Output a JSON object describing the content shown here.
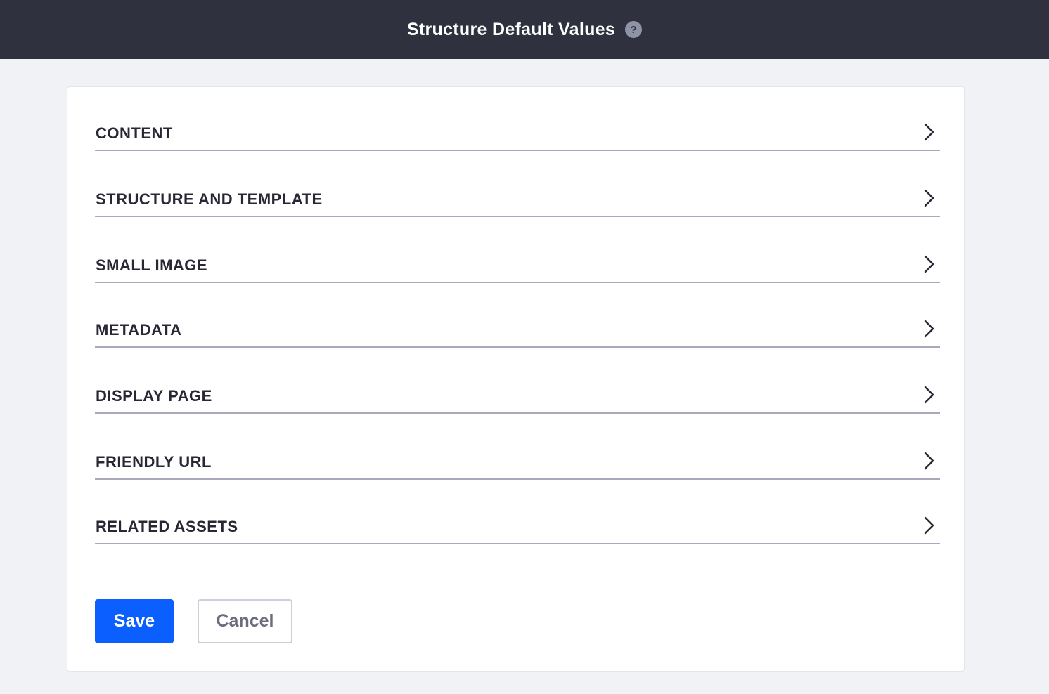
{
  "header": {
    "title": "Structure Default Values",
    "help_icon": "?",
    "help_icon_name": "question-circle-icon"
  },
  "sections": [
    {
      "label": "CONTENT",
      "icon": "chevron-right-icon"
    },
    {
      "label": "STRUCTURE AND TEMPLATE",
      "icon": "chevron-right-icon"
    },
    {
      "label": "SMALL IMAGE",
      "icon": "chevron-right-icon"
    },
    {
      "label": "METADATA",
      "icon": "chevron-right-icon"
    },
    {
      "label": "DISPLAY PAGE",
      "icon": "chevron-right-icon"
    },
    {
      "label": "FRIENDLY URL",
      "icon": "chevron-right-icon"
    },
    {
      "label": "RELATED ASSETS",
      "icon": "chevron-right-icon"
    }
  ],
  "actions": {
    "save_label": "Save",
    "cancel_label": "Cancel"
  },
  "colors": {
    "header_bg": "#30313f",
    "page_bg": "#f1f2f5",
    "primary": "#0b5fff",
    "divider": "#a7a9bc",
    "text": "#272833"
  }
}
